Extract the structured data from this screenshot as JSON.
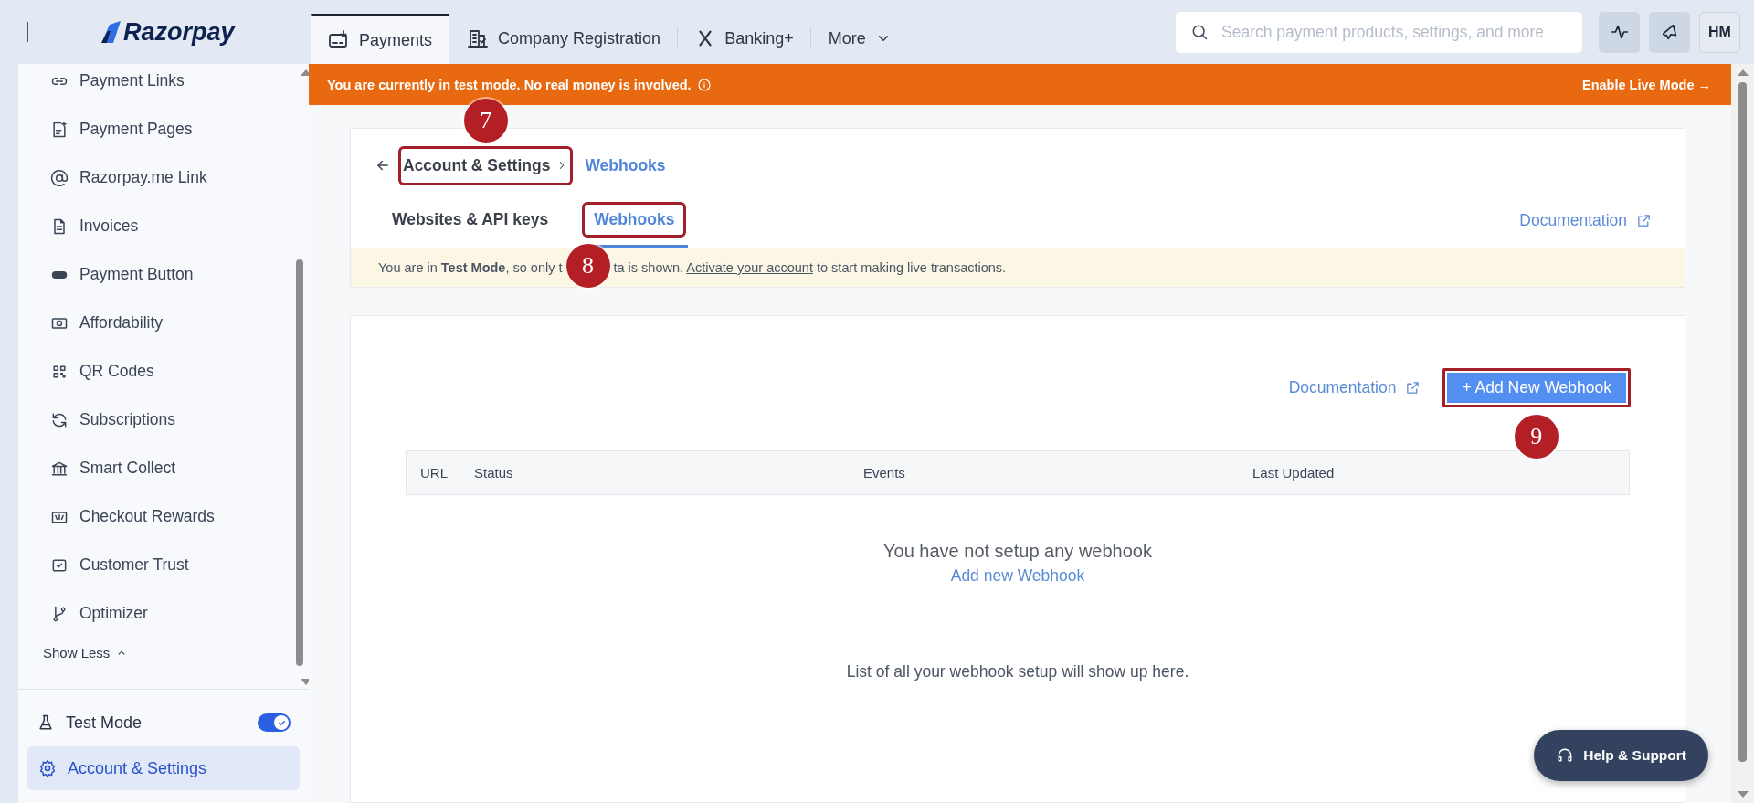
{
  "topbar": {
    "logo": "Razorpay",
    "tabs": [
      {
        "label": "Payments",
        "selected": true
      },
      {
        "label": "Company Registration",
        "selected": false
      },
      {
        "label": "Banking+",
        "selected": false
      },
      {
        "label": "More",
        "selected": false
      }
    ],
    "search": {
      "placeholder": "Search payment products, settings, and more"
    },
    "avatar": "HM"
  },
  "sidebar": {
    "items": [
      {
        "label": "Payment Links"
      },
      {
        "label": "Payment Pages"
      },
      {
        "label": "Razorpay.me Link"
      },
      {
        "label": "Invoices"
      },
      {
        "label": "Payment Button"
      },
      {
        "label": "Affordability"
      },
      {
        "label": "QR Codes"
      },
      {
        "label": "Subscriptions"
      },
      {
        "label": "Smart Collect"
      },
      {
        "label": "Checkout Rewards"
      },
      {
        "label": "Customer Trust"
      },
      {
        "label": "Optimizer"
      }
    ],
    "show_less": "Show Less",
    "test_mode": {
      "label": "Test Mode",
      "on": true
    },
    "settings": {
      "label": "Account & Settings",
      "selected": true
    }
  },
  "test_banner": {
    "text": "You are currently in test mode. No real money is involved.",
    "action": "Enable Live Mode →"
  },
  "header_card": {
    "breadcrumb": [
      {
        "label": "Account & Settings",
        "highlighted": true,
        "callout": {
          "number": "7"
        }
      },
      {
        "label": "Webhooks",
        "highlighted": false
      }
    ],
    "tabs": [
      {
        "label": "Websites & API keys",
        "selected": false,
        "highlighted": false
      },
      {
        "label": "Webhooks",
        "selected": true,
        "highlighted": true,
        "callout": {
          "number": "8"
        }
      }
    ],
    "documentation": "Documentation",
    "notice": {
      "before": "You are in **Test Mode**, so only t",
      "after": "ta is shown.",
      "link": "Activate your account",
      "end": "to start making live transactions."
    }
  },
  "webhooks_card": {
    "documentation": "Documentation",
    "add_button": {
      "label": "+ Add New Webhook",
      "highlighted": true,
      "callout": {
        "number": "9"
      }
    },
    "table": {
      "columns": [
        "URL",
        "Status",
        "Events",
        "Last Updated"
      ]
    },
    "empty_title": "You have not setup any webhook",
    "empty_link": "Add new Webhook",
    "empty_note": "List of all your webhook setup will show up here."
  },
  "help_button": "Help & Support"
}
